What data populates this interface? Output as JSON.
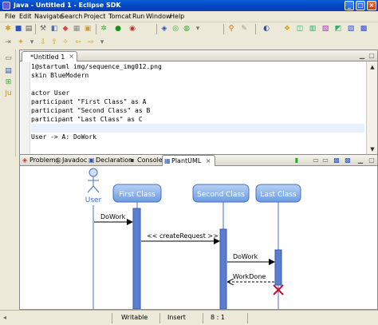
{
  "window": {
    "title": "Java - Untitled 1 - Eclipse SDK"
  },
  "menu": [
    "File",
    "Edit",
    "Navigate",
    "Search",
    "Project",
    "Tomcat",
    "Run",
    "Window",
    "Help"
  ],
  "editor": {
    "tab_title": "*Untitled 1",
    "lines": [
      "1@startuml img/sequence_img012.png",
      "skin BlueModern",
      "",
      "actor User",
      "participant \"First Class\" as A",
      "participant \"Second Class\" as B",
      "participant \"Last Class\" as C",
      "",
      "User -> A: DoWork"
    ]
  },
  "bottom_tabs": [
    {
      "label": "Problems",
      "icon": "problems-icon"
    },
    {
      "label": "Javadoc",
      "icon": "at-icon"
    },
    {
      "label": "Declaration",
      "icon": "declaration-icon"
    },
    {
      "label": "Console",
      "icon": "console-icon"
    },
    {
      "label": "PlantUML",
      "icon": "plantuml-icon",
      "active": true
    }
  ],
  "diagram": {
    "actor": "User",
    "participants": [
      "First Class",
      "Second Class",
      "Last Class"
    ],
    "messages": [
      {
        "label": "DoWork"
      },
      {
        "label": "<< createRequest >>"
      },
      {
        "label": "DoWork"
      },
      {
        "label": "WorkDone"
      }
    ]
  },
  "status": {
    "mode": "Writable",
    "insert": "Insert",
    "position": "8 : 1"
  },
  "colors": {
    "participant_fill": "#8fb6e8",
    "lifeline": "#4a6fc5",
    "activation": "#5a7dd0"
  }
}
